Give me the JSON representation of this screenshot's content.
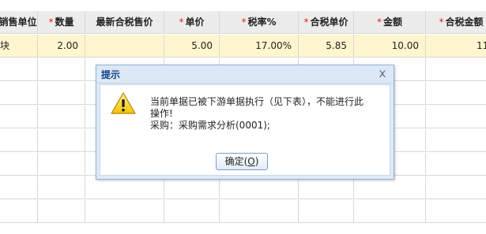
{
  "table": {
    "columns": [
      {
        "label": "销售单位",
        "required": false
      },
      {
        "label": "数量",
        "required": true
      },
      {
        "label": "最新合税售价",
        "required": false
      },
      {
        "label": "单价",
        "required": true
      },
      {
        "label": "税率%",
        "required": true
      },
      {
        "label": "合税单价",
        "required": true
      },
      {
        "label": "金额",
        "required": true
      },
      {
        "label": "合税金额",
        "required": true
      }
    ],
    "selected_row": [
      "块",
      "2.00",
      "",
      "5.00",
      "17.00%",
      "5.85",
      "10.00",
      "11."
    ]
  },
  "dialog": {
    "title": "提示",
    "close_glyph": "x",
    "message_line1": "当前单据已被下游单据执行（见下表），不能进行此",
    "message_line2": "操作!",
    "message_line3": "采购：采购需求分析(0001);",
    "ok_label_prefix": "确定(",
    "ok_hotkey": "O",
    "ok_label_suffix": ")",
    "icon": "warning-icon"
  }
}
